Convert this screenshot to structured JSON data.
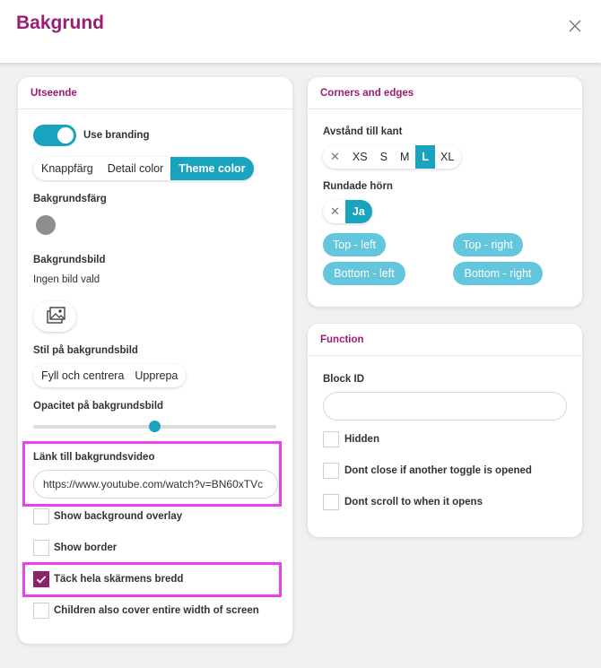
{
  "dialog": {
    "title": "Bakgrund",
    "close_icon": "close-icon"
  },
  "colors": {
    "accent": "#1aa3bf",
    "brand": "#9b1d74",
    "highlight": "#ee3fee",
    "checkbox_checked": "#8e2168"
  },
  "appearance": {
    "heading": "Utseende",
    "use_branding_label": "Use branding",
    "use_branding_on": true,
    "color_tabs": [
      "Knappfärg",
      "Detail color",
      "Theme color"
    ],
    "color_tabs_active": "Theme color",
    "bg_color_label": "Bakgrundsfärg",
    "bg_color_value": "#8e8e8e",
    "bg_image_label": "Bakgrundsbild",
    "bg_image_value": "Ingen bild vald",
    "bg_image_icon": "image-gallery-icon",
    "bg_style_label": "Stil på bakgrundsbild",
    "bg_style_options": [
      "Fyll och centrera",
      "Upprepa"
    ],
    "opacity_label": "Opacitet på bakgrundsbild",
    "opacity_value": 0.5,
    "video_link_label": "Länk till bakgrundsvideo",
    "video_link_value": "https://www.youtube.com/watch?v=BN60xTVc",
    "checkboxes": [
      {
        "label": "Show background overlay",
        "checked": false
      },
      {
        "label": "Show border",
        "checked": false
      },
      {
        "label": "Täck hela skärmens bredd",
        "checked": true
      },
      {
        "label": "Children also cover entire width of screen",
        "checked": false
      }
    ]
  },
  "corners": {
    "heading": "Corners and edges",
    "distance_label": "Avstånd till kant",
    "distance_options": [
      "✕",
      "XS",
      "S",
      "M",
      "L",
      "XL"
    ],
    "distance_active": "L",
    "rounded_label": "Rundade hörn",
    "rounded_options": [
      "✕",
      "Ja"
    ],
    "rounded_active": "Ja",
    "corner_buttons": [
      "Top - left",
      "Top - right",
      "Bottom - left",
      "Bottom - right"
    ]
  },
  "function": {
    "heading": "Function",
    "block_id_label": "Block ID",
    "block_id_value": "",
    "checkboxes": [
      {
        "label": "Hidden",
        "checked": false
      },
      {
        "label": "Dont close if another toggle is opened",
        "checked": false
      },
      {
        "label": "Dont scroll to when it opens",
        "checked": false
      }
    ]
  }
}
